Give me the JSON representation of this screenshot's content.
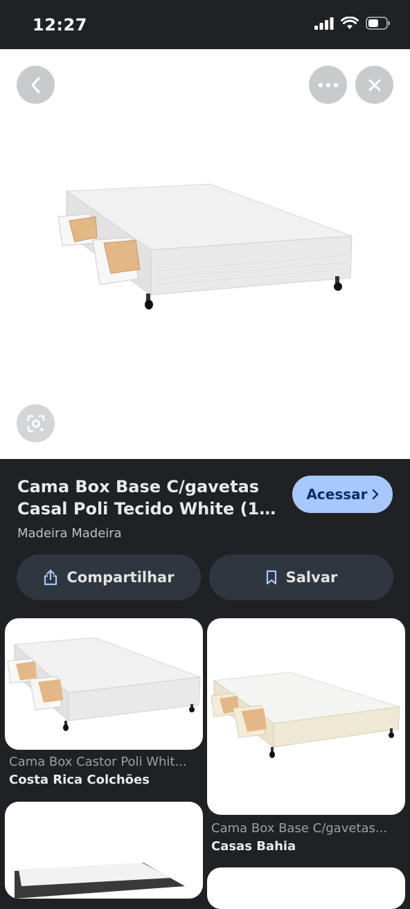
{
  "status_bar": {
    "time": "12:27"
  },
  "product": {
    "title_line1": "Cama Box Base C/gavetas",
    "title_line2": "Casal Poli Tecido White (138x...",
    "source": "Madeira Madeira",
    "visit_label": "Acessar",
    "share_label": "Compartilhar",
    "save_label": "Salvar"
  },
  "related": [
    {
      "title": "Cama Box Castor Poli Whit...",
      "source": "Costa Rica Colchões"
    },
    {
      "title": "Cama Box Base C/gavetas...",
      "source": "Casas Bahia"
    }
  ],
  "colors": {
    "background": "#202124",
    "visit_button": "#a8c7fa",
    "action_button": "#303640"
  },
  "icons": [
    "back-icon",
    "more-icon",
    "close-icon",
    "lens-icon",
    "share-icon",
    "bookmark-icon",
    "chevron-right-icon"
  ]
}
